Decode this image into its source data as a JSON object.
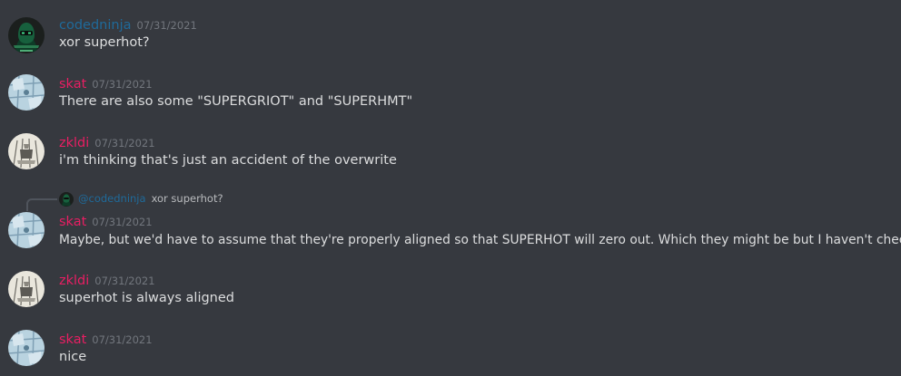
{
  "colors": {
    "background": "#36393f",
    "codedninja": "#1f6a9a",
    "skat": "#e91e63",
    "zkldi": "#e91e63",
    "message_text": "#dcddde",
    "timestamp": "#72767d"
  },
  "messages": [
    {
      "author": "codedninja",
      "timestamp": "07/31/2021",
      "content": "xor superhot?"
    },
    {
      "author": "skat",
      "timestamp": "07/31/2021",
      "content": "There are also some \"SUPERGRIOT\" and \"SUPERHMT\""
    },
    {
      "author": "zkldi",
      "timestamp": "07/31/2021",
      "content": "i'm thinking that's just an accident of the overwrite"
    },
    {
      "author": "skat",
      "timestamp": "07/31/2021",
      "content": "Maybe, but we'd have to assume that they're properly aligned so that SUPERHOT will zero out. Which they might be but I haven't checked."
    },
    {
      "author": "zkldi",
      "timestamp": "07/31/2021",
      "content": "superhot is always aligned"
    },
    {
      "author": "skat",
      "timestamp": "07/31/2021",
      "content": "nice"
    }
  ],
  "reply": {
    "mention": "@codedninja",
    "snippet": "xor superhot?",
    "avatar_icon": "ninja-avatar-icon"
  },
  "avatars": {
    "codedninja": "ninja-avatar-icon",
    "skat": "map-avatar-icon",
    "zkldi": "sketch-avatar-icon"
  }
}
